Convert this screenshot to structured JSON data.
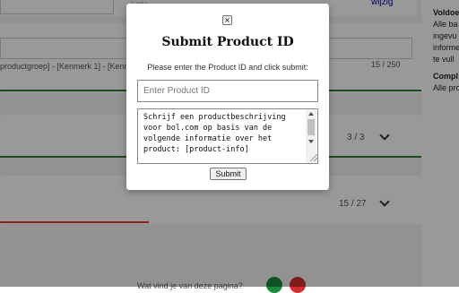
{
  "background": {
    "top_field_text": "Lotje",
    "edit_link": "wijzig",
    "title_path": "productgroep] - [Kenmerk 1] - [Kenmerk",
    "title_counter": "15 / 250",
    "section_counter": "3 / 3",
    "description_counter": "15 / 27",
    "feedback_question": "Wat vind je van deze pagina?",
    "sidebar": {
      "heading1": "Voldoe",
      "lines1": [
        "Alle ba",
        "ingevu",
        "informe",
        "te vull"
      ],
      "heading2": "Compl",
      "lines2": [
        "Alle pro"
      ]
    },
    "colors": {
      "progress_green": "#2e7d32",
      "progress_red": "#e53935",
      "thumb_green": "#1b8a3a",
      "thumb_red": "#d32f2f"
    }
  },
  "modal": {
    "close_label": "×",
    "title": "Submit Product ID",
    "instruction": "Please enter the Product ID and click submit:",
    "product_id_value": "",
    "product_id_placeholder": "Enter Product ID",
    "prompt_text": "Schrijf een productbeschrijving voor bol.com op basis van de volgende informatie over het product: [product-info]",
    "submit_label": "Submit"
  }
}
